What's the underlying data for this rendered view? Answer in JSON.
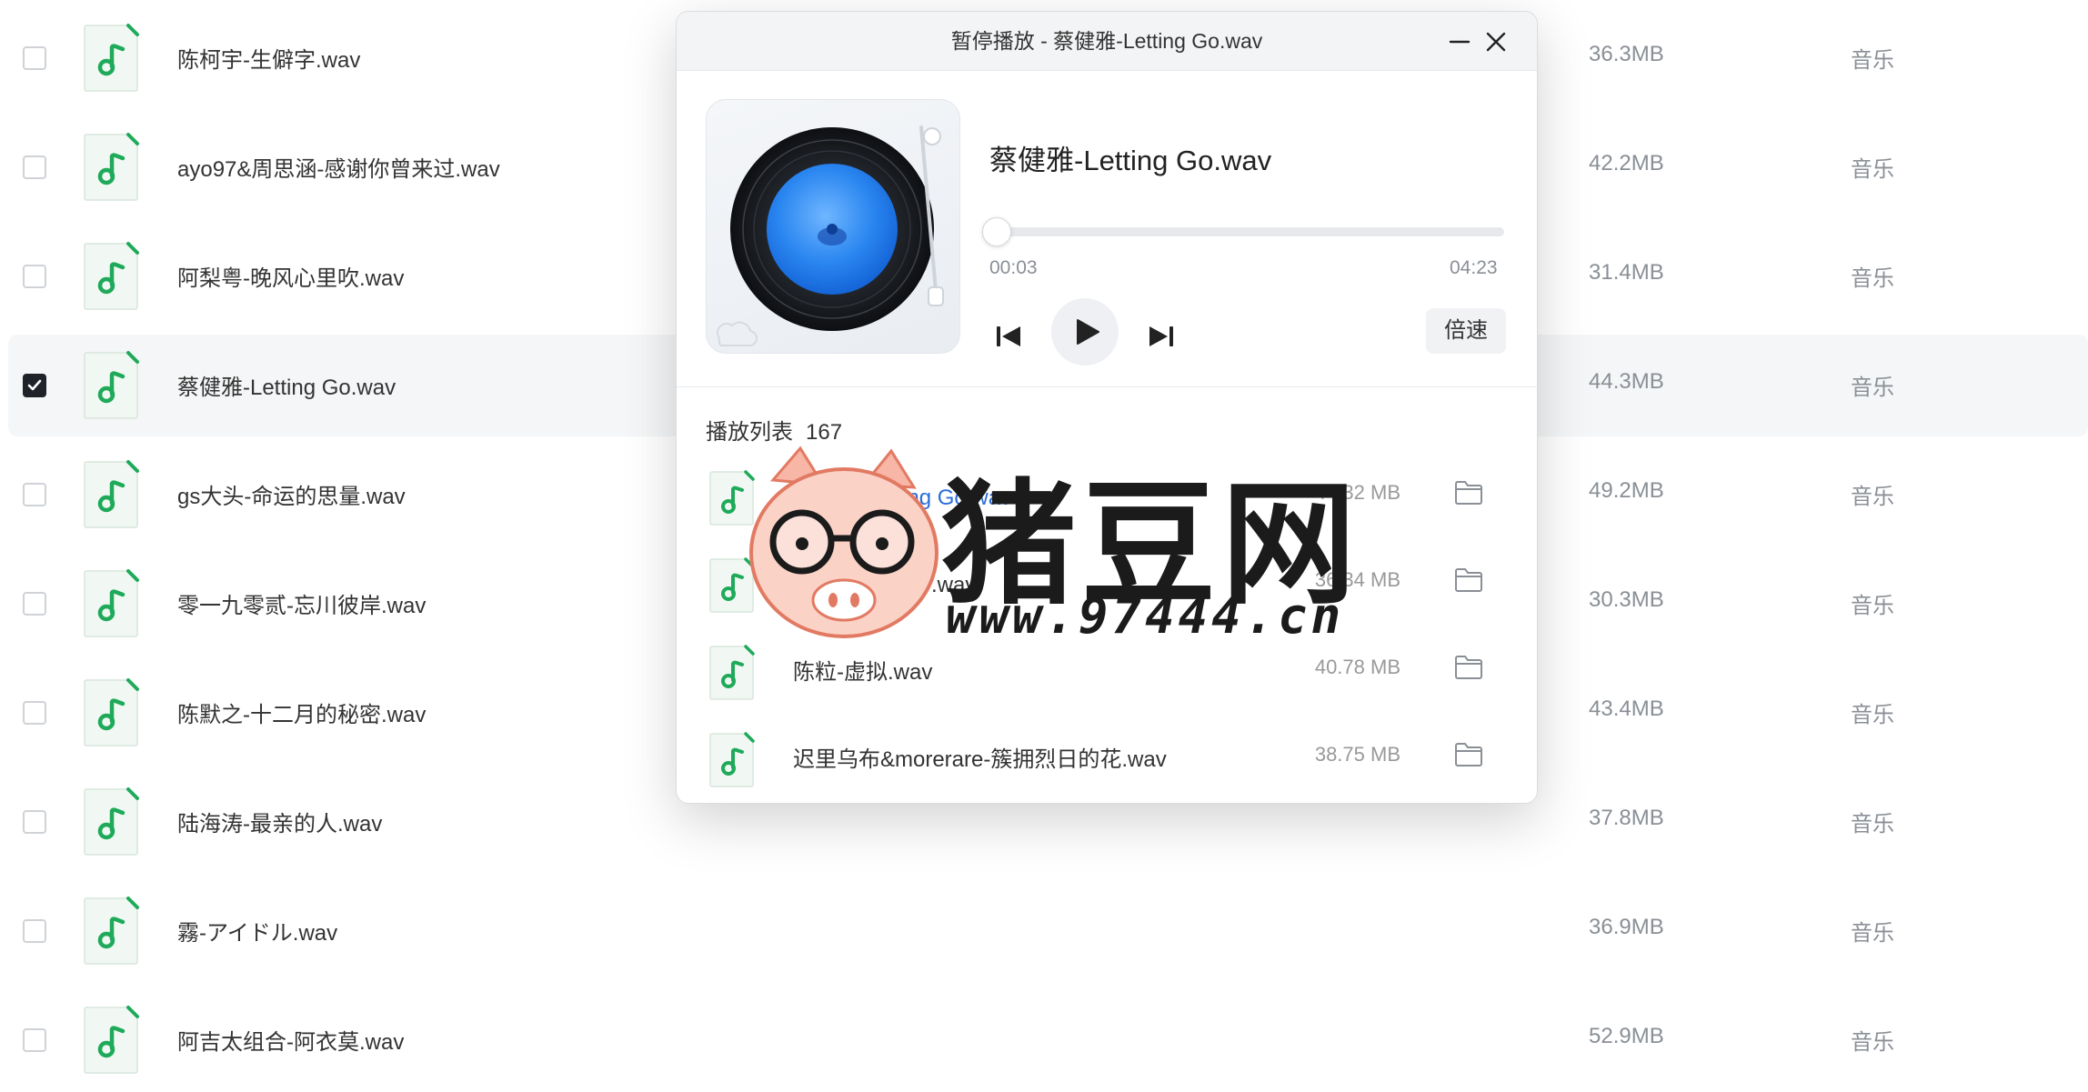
{
  "files": [
    {
      "name": "陈柯宇-生僻字.wav",
      "size": "36.3MB",
      "type": "音乐",
      "checked": false
    },
    {
      "name": "ayo97&周思涵-感谢你曾来过.wav",
      "size": "42.2MB",
      "type": "音乐",
      "checked": false
    },
    {
      "name": "阿梨粤-晚风心里吹.wav",
      "size": "31.4MB",
      "type": "音乐",
      "checked": false
    },
    {
      "name": "蔡健雅-Letting Go.wav",
      "size": "44.3MB",
      "type": "音乐",
      "checked": true
    },
    {
      "name": "gs大头-命运的思量.wav",
      "size": "49.2MB",
      "type": "音乐",
      "checked": false
    },
    {
      "name": "零一九零贰-忘川彼岸.wav",
      "size": "30.3MB",
      "type": "音乐",
      "checked": false
    },
    {
      "name": "陈默之-十二月的秘密.wav",
      "size": "43.4MB",
      "type": "音乐",
      "checked": false
    },
    {
      "name": "陆海涛-最亲的人.wav",
      "size": "37.8MB",
      "type": "音乐",
      "checked": false
    },
    {
      "name": "霧-アイドル.wav",
      "size": "36.9MB",
      "type": "音乐",
      "checked": false
    },
    {
      "name": "阿吉太组合-阿衣莫.wav",
      "size": "52.9MB",
      "type": "音乐",
      "checked": false
    }
  ],
  "player": {
    "title": "暂停播放 - 蔡健雅-Letting Go.wav",
    "track_title": "蔡健雅-Letting Go.wav",
    "current_time": "00:03",
    "total_time": "04:23",
    "progress": 0.012,
    "speed_label": "倍速",
    "playlist_label": "播放列表",
    "playlist_count": "167",
    "playlist": [
      {
        "name": "蔡健雅-Letting Go.wav",
        "size": "44.32 MB",
        "current": true
      },
      {
        "name": "陈柯宇-生僻字.wav",
        "size": "36.34 MB",
        "current": false
      },
      {
        "name": "陈粒-虚拟.wav",
        "size": "40.78 MB",
        "current": false
      },
      {
        "name": "迟里乌布&morerare-簇拥烈日的花.wav",
        "size": "38.75 MB",
        "current": false
      }
    ]
  },
  "icons": {
    "file": "music-file-icon",
    "checkbox_check": "check-icon",
    "minimize": "minimize-icon",
    "close": "close-icon",
    "prev": "skip-previous-icon",
    "play": "play-icon",
    "next": "skip-next-icon",
    "folder": "folder-icon"
  },
  "colors": {
    "accent_green": "#1faa5a",
    "current_track_blue": "#2a6dd9",
    "checkbox_checked": "#1f2329"
  },
  "watermark": {
    "logo_text": "猪豆网",
    "url": "www.97444.cn"
  }
}
